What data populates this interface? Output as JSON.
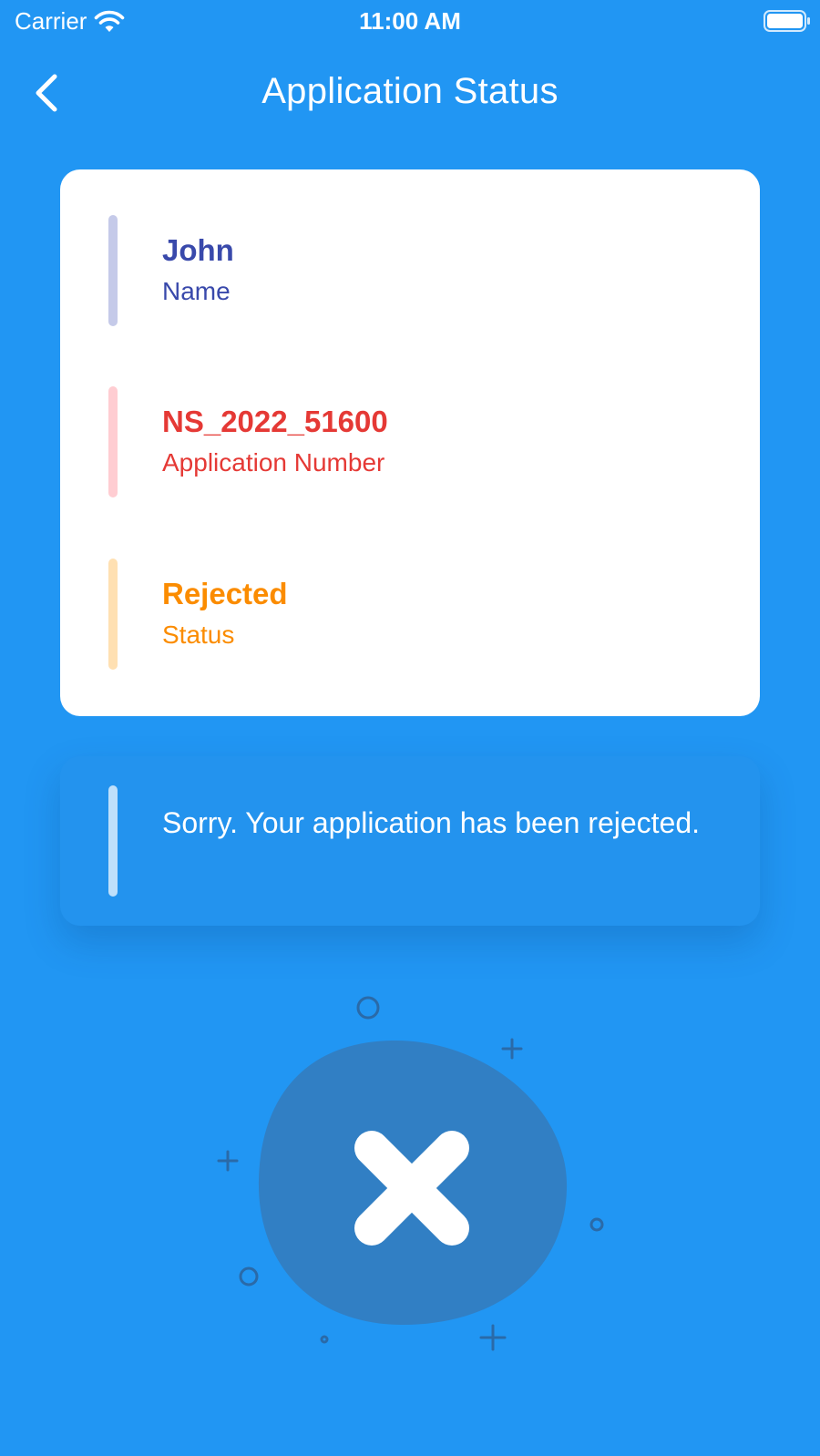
{
  "status_bar": {
    "carrier": "Carrier",
    "time": "11:00 AM",
    "icons": [
      "wifi-icon",
      "battery-icon"
    ]
  },
  "nav": {
    "title": "Application Status",
    "back_icon": "chevron-left-icon"
  },
  "info_card": {
    "rows": [
      {
        "value": "John",
        "label": "Name",
        "color": "#3949AB",
        "accent": "#C5CAE9"
      },
      {
        "value": "NS_2022_51600",
        "label": "Application Number",
        "color": "#E53935",
        "accent": "#FFCDD2"
      },
      {
        "value": "Rejected",
        "label": "Status",
        "color": "#FB8C00",
        "accent": "#FFE0B2"
      }
    ]
  },
  "message": {
    "text": "Sorry. Your application has been rejected."
  },
  "illustration": {
    "icon": "close-icon",
    "blob_color": "#317FC4",
    "decoration_color": "#2a6aa8"
  },
  "colors": {
    "background": "#2196F3",
    "card": "#FFFFFF"
  }
}
